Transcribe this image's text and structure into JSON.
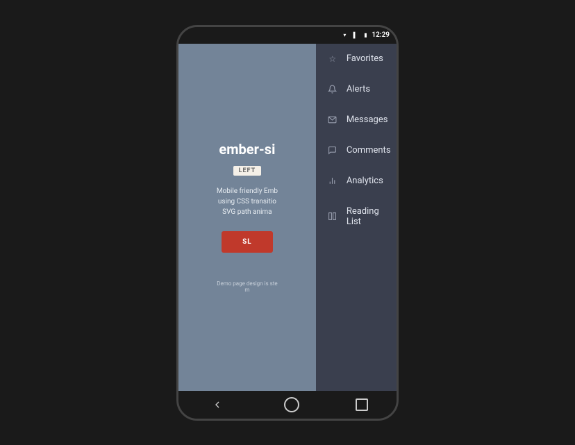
{
  "status_bar": {
    "time": "12:29",
    "icons": [
      "signal",
      "wifi",
      "battery"
    ]
  },
  "app_panel": {
    "title": "ember-si",
    "badge": "LEFT",
    "description": "Mobile friendly Emb\nusing CSS transitio\nSVG path anima",
    "button_label": "SL",
    "footer": "Demo page design is ste\nm"
  },
  "drawer": {
    "items": [
      {
        "id": "favorites",
        "icon": "☆",
        "label": "Favorites"
      },
      {
        "id": "alerts",
        "icon": "🔔",
        "label": "Alerts"
      },
      {
        "id": "messages",
        "icon": "✉",
        "label": "Messages"
      },
      {
        "id": "comments",
        "icon": "💬",
        "label": "Comments"
      },
      {
        "id": "analytics",
        "icon": "📊",
        "label": "Analytics"
      },
      {
        "id": "reading-list",
        "icon": "📋",
        "label": "Reading List"
      }
    ]
  },
  "nav_bar": {
    "back": "◁",
    "home": "",
    "recents": ""
  }
}
